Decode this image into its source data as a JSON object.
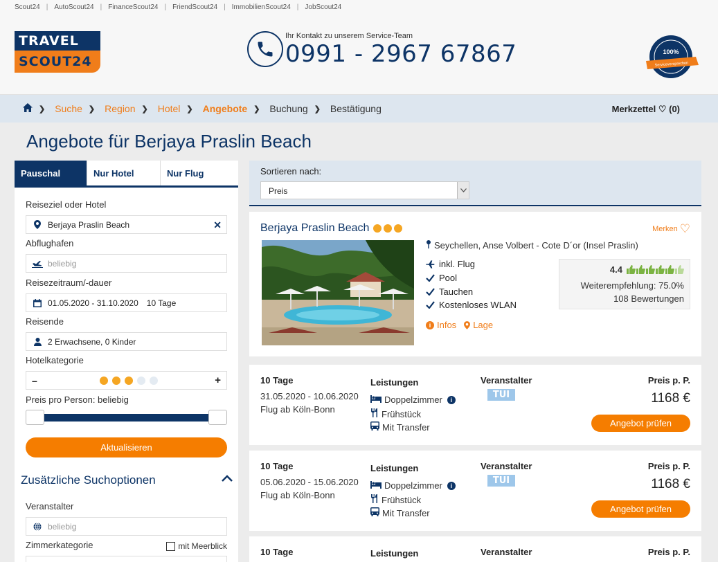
{
  "top_links": [
    "Scout24",
    "AutoScout24",
    "FinanceScout24",
    "FriendScout24",
    "ImmobilienScout24",
    "JobScout24"
  ],
  "logo": {
    "line1": "TRAVEL",
    "line2": "SCOUT24"
  },
  "contact": {
    "label": "Ihr Kontakt zu unserem Service-Team",
    "number": "0991 - 2967 67867"
  },
  "seal": {
    "text": "100%",
    "ribbon": "Serviceversprechen",
    "ring": "TRAVELSCOUT24"
  },
  "breadcrumb": [
    {
      "label": "Suche"
    },
    {
      "label": "Region"
    },
    {
      "label": "Hotel"
    },
    {
      "label": "Angebote"
    },
    {
      "label": "Buchung"
    },
    {
      "label": "Bestätigung"
    }
  ],
  "merkzettel": {
    "label": "Merkzettel",
    "count": "(0)"
  },
  "page_title": "Angebote für Berjaya Praslin Beach",
  "sidebar": {
    "tabs": [
      "Pauschal",
      "Nur Hotel",
      "Nur Flug"
    ],
    "reiseziel": {
      "label": "Reiseziel oder Hotel",
      "value": "Berjaya Praslin Beach"
    },
    "abflughafen": {
      "label": "Abflughafen",
      "placeholder": "beliebig"
    },
    "zeitraum": {
      "label": "Reisezeitraum/-dauer",
      "value": "01.05.2020 - 31.10.2020",
      "duration": "10 Tage"
    },
    "reisende": {
      "label": "Reisende",
      "value": "2 Erwachsene, 0 Kinder"
    },
    "hotelkategorie": {
      "label": "Hotelkategorie",
      "minus": "–",
      "plus": "+",
      "level": 3,
      "max": 5
    },
    "preis": {
      "label": "Preis pro Person: beliebig"
    },
    "update_label": "Aktualisieren",
    "zusatz_label": "Zusätzliche Suchoptionen",
    "veranstalter": {
      "label": "Veranstalter",
      "placeholder": "beliebig"
    },
    "zimmerkategorie": {
      "label": "Zimmerkategorie"
    },
    "meerblick_label": "mit Meerblick"
  },
  "sort": {
    "label": "Sortieren nach:",
    "selected": "Preis"
  },
  "hotel": {
    "name": "Berjaya Praslin Beach",
    "stars": 3,
    "merken": "Merken",
    "location": "Seychellen, Anse Volbert - Cote D´or (Insel Praslin)",
    "features": [
      "inkl. Flug",
      "Pool",
      "Tauchen",
      "Kostenloses WLAN"
    ],
    "infos_label": "Infos",
    "lage_label": "Lage",
    "rating": {
      "score": "4.4",
      "thumbs": 6,
      "thumbs_filled": 5,
      "recommendation": "Weiterempfehlung: 75.0%",
      "reviews": "108 Bewertungen"
    }
  },
  "offers": [
    {
      "duration": "10 Tage",
      "dates": "31.05.2020 - 10.06.2020",
      "departure": "Flug ab Köln-Bonn",
      "services_label": "Leistungen",
      "services": [
        "Doppelzimmer",
        "Frühstück",
        "Mit Transfer"
      ],
      "operator_label": "Veranstalter",
      "operator": "TUI",
      "price_label": "Preis p. P.",
      "price": "1168 €",
      "button": "Angebot prüfen"
    },
    {
      "duration": "10 Tage",
      "dates": "05.06.2020 - 15.06.2020",
      "departure": "Flug ab Köln-Bonn",
      "services_label": "Leistungen",
      "services": [
        "Doppelzimmer",
        "Frühstück",
        "Mit Transfer"
      ],
      "operator_label": "Veranstalter",
      "operator": "TUI",
      "price_label": "Preis p. P.",
      "price": "1168 €",
      "button": "Angebot prüfen"
    },
    {
      "duration": "10 Tage",
      "services_label": "Leistungen",
      "operator_label": "Veranstalter",
      "price_label": "Preis p. P."
    }
  ],
  "colors": {
    "navy": "#0d3466",
    "orange": "#f57d00",
    "star": "#f5a623",
    "thumb": "#7bb342"
  }
}
